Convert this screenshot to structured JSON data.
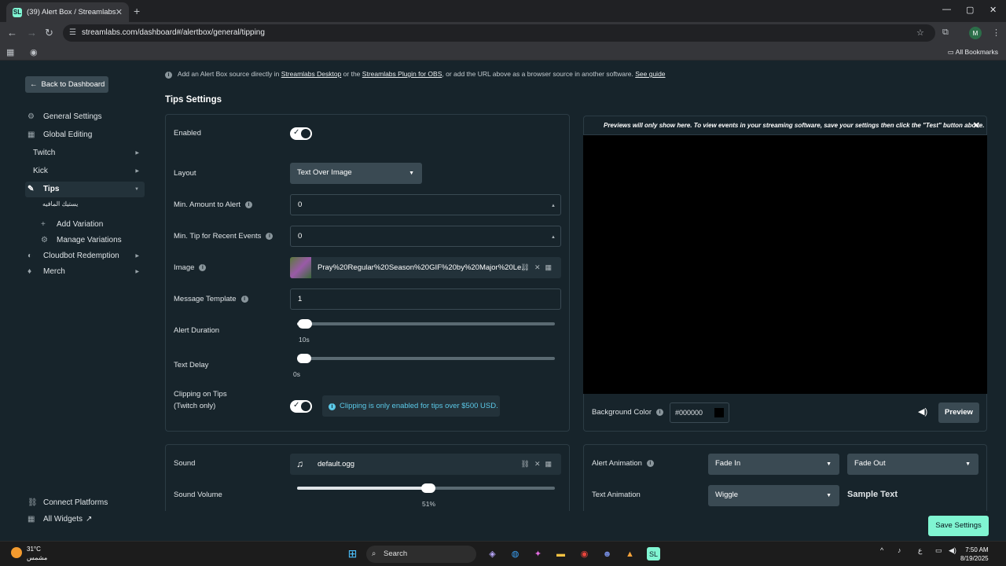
{
  "browser": {
    "tab_title": "(39) Alert Box / Streamlabs",
    "tab_favicon": "SL",
    "tab_close": "✕",
    "new_tab": "+",
    "url": "streamlabs.com/dashboard#/alertbox/general/tipping",
    "all_bookmarks": "All Bookmarks",
    "profile_initial": "M"
  },
  "sidebar": {
    "back_label": "Back to Dashboard",
    "items": [
      {
        "label": "General Settings",
        "icon": "gear-icon"
      },
      {
        "label": "Global Editing",
        "icon": "grid-icon"
      },
      {
        "label": "Twitch",
        "icon": "none"
      },
      {
        "label": "Kick",
        "icon": "none"
      },
      {
        "label": "Tips",
        "icon": "tips-icon"
      },
      {
        "label": "يستيك المافيه",
        "icon": "none"
      },
      {
        "label": "Add Variation",
        "icon": "plus-icon"
      },
      {
        "label": "Manage Variations",
        "icon": "gear-icon"
      },
      {
        "label": "Cloudbot Redemption",
        "icon": "cloudbot-icon"
      },
      {
        "label": "Merch",
        "icon": "shirt-icon"
      }
    ],
    "connect_platforms": "Connect Platforms",
    "all_widgets": "All Widgets"
  },
  "info": {
    "prefix": "Add an Alert Box source directly in",
    "link1": "Streamlabs Desktop",
    "mid": "or the",
    "link2": "Streamlabs Plugin for OBS",
    "suffix": ", or add the URL above as a browser source in another software.",
    "link3": "See guide"
  },
  "tips_settings": {
    "title": "Tips Settings",
    "enabled_label": "Enabled",
    "layout_label": "Layout",
    "layout_value": "Text Over Image",
    "min_amount_label": "Min. Amount to Alert",
    "min_amount_value": "0",
    "min_tip_label": "Min. Tip for Recent Events",
    "min_tip_value": "0",
    "image_label": "Image",
    "image_name": "Pray%20Regular%20Season%20GIF%20by%20Major%20Le...",
    "message_template_label": "Message Template",
    "message_template_value": "1",
    "alert_duration_label": "Alert Duration",
    "alert_duration_value": "10s",
    "alert_duration_level": 0.03,
    "text_delay_label": "Text Delay",
    "text_delay_value": "0s",
    "text_delay_level": 0,
    "clipping_label_1": "Clipping on Tips",
    "clipping_label_2": "(Twitch only)",
    "clipping_notice": "Clipping is only enabled for tips over $500 USD."
  },
  "preview": {
    "notice": "Previews will only show here. To view events in your streaming software, save your settings then click the \"Test\" button above.",
    "close": "✕",
    "background_color_label": "Background Color",
    "background_color_value": "#000000",
    "preview_button": "Preview"
  },
  "sound": {
    "sound_label": "Sound",
    "sound_file": "default.ogg",
    "volume_label": "Sound Volume",
    "volume_value": "51%",
    "volume_level": 0.51
  },
  "animation": {
    "alert_animation_label": "Alert Animation",
    "in_value": "Fade In",
    "out_value": "Fade Out",
    "text_animation_label": "Text Animation",
    "text_animation_value": "Wiggle",
    "sample_text": "Sample Text"
  },
  "save_button": "Save Settings",
  "taskbar": {
    "temperature": "31°C",
    "weather": "مشمس",
    "search": "Search",
    "lang": "ع",
    "time": "7:50 AM",
    "date": "8/19/2025"
  },
  "colors": {
    "accent": "#80f5d2",
    "background": "#17242b",
    "panel_border": "#2c3c45",
    "info_link": "#5bc9e8"
  }
}
